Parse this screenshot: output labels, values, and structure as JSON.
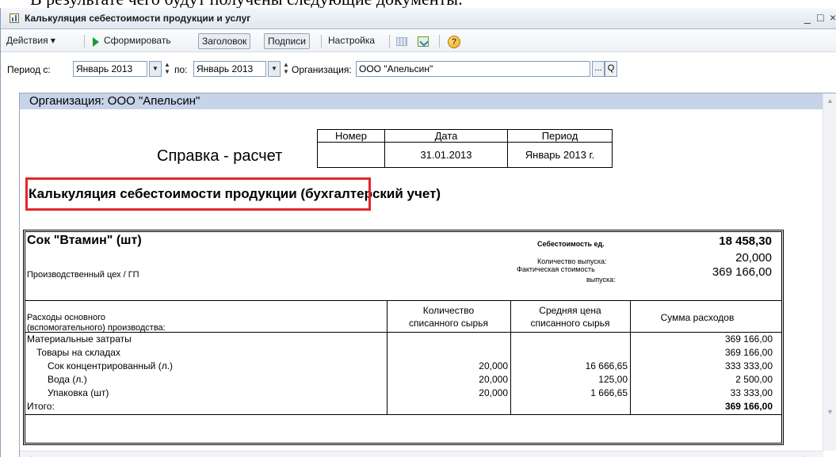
{
  "background_text": "В результате чего будут получены следующие документы:",
  "window": {
    "title": "Калькуляция себестоимости продукции и услуг",
    "controls": {
      "minimize": "_",
      "maximize": "□",
      "close": "×"
    }
  },
  "toolbar": {
    "actions_label": "Действия ▾",
    "generate_label": "Сформировать",
    "header_label": "Заголовок",
    "signatures_label": "Подписи",
    "settings_label": "Настройка",
    "icons": [
      "play-icon",
      "grid-icon",
      "export-icon",
      "help-icon"
    ]
  },
  "filters": {
    "period_from_label": "Период с:",
    "period_from_value": "Январь 2013",
    "period_to_label": "по:",
    "period_to_value": "Январь 2013",
    "org_label": "Организация:",
    "org_value": "ООО \"Апельсин\"",
    "select_button": "...",
    "open_button": "Q"
  },
  "report": {
    "org_band": "Организация: ООО \"Апельсин\"",
    "doc_title": "Справка - расчет",
    "header_table": {
      "headers": [
        "Номер",
        "Дата",
        "Период"
      ],
      "values": [
        "",
        "31.01.2013",
        "Январь 2013 г."
      ]
    },
    "heading": "Калькуляция себестоимости продукции (бухгалтерский учет)",
    "product": {
      "name": "Сок \"Втамин\" (шт)",
      "department": "Производственный цех / ГП",
      "unit_cost_label": "Себестоимость ед.",
      "unit_cost_value": "18 458,30",
      "qty_label": "Количество выпуска:",
      "qty_value": "20,000",
      "actual_cost_label_1": "Фактическая стоимость",
      "actual_cost_label_2": "выпуска:",
      "actual_cost_value": "369 166,00"
    },
    "columns": {
      "expenses_1": "Расходы основного",
      "expenses_2": "(вспомогательного) производства:",
      "qty_1": "Количество",
      "qty_2": "списанного сырья",
      "price_1": "Средняя цена",
      "price_2": "списанного сырья",
      "sum": "Сумма расходов"
    },
    "rows": [
      {
        "name": "Материальные затраты",
        "qty": "",
        "price": "",
        "sum": "369 166,00"
      },
      {
        "name": "Товары на складах",
        "qty": "",
        "price": "",
        "sum": "369 166,00"
      },
      {
        "name": "Сок концентрированный (л.)",
        "qty": "20,000",
        "price": "16 666,65",
        "sum": "333 333,00"
      },
      {
        "name": "Вода (л.)",
        "qty": "20,000",
        "price": "125,00",
        "sum": "2 500,00"
      },
      {
        "name": "Упаковка (шт)",
        "qty": "20,000",
        "price": "1 666,65",
        "sum": "33 333,00"
      }
    ],
    "total": {
      "label": "Итого:",
      "sum": "369 166,00"
    }
  },
  "colors": {
    "org_band": "#c6d3e8",
    "highlight_frame": "#e2262c",
    "generate_icon": "#1b9b2e"
  }
}
